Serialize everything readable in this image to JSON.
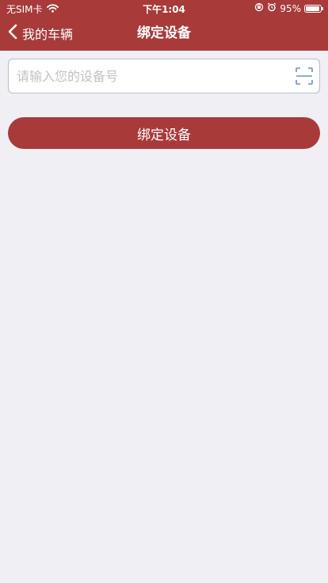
{
  "status_bar": {
    "carrier": "无SIM卡",
    "time": "下午1:04",
    "battery_text": "95%",
    "battery_level": 0.95
  },
  "nav": {
    "back_label": "我的车辆",
    "title": "绑定设备"
  },
  "form": {
    "device_input_placeholder": "请输入您的设备号",
    "device_input_value": "",
    "bind_button_label": "绑定设备"
  },
  "icons": {
    "back": "chevron-left-icon",
    "scan": "scan-icon",
    "wifi": "wifi-icon",
    "rotation_lock": "rotation-lock-icon",
    "alarm": "alarm-icon",
    "battery": "battery-icon"
  },
  "colors": {
    "primary": "#a83a3a",
    "background": "#efeff4",
    "input_border": "#b9c0cf",
    "scan_icon": "#6f8fb3",
    "placeholder": "#c2c2c8"
  }
}
